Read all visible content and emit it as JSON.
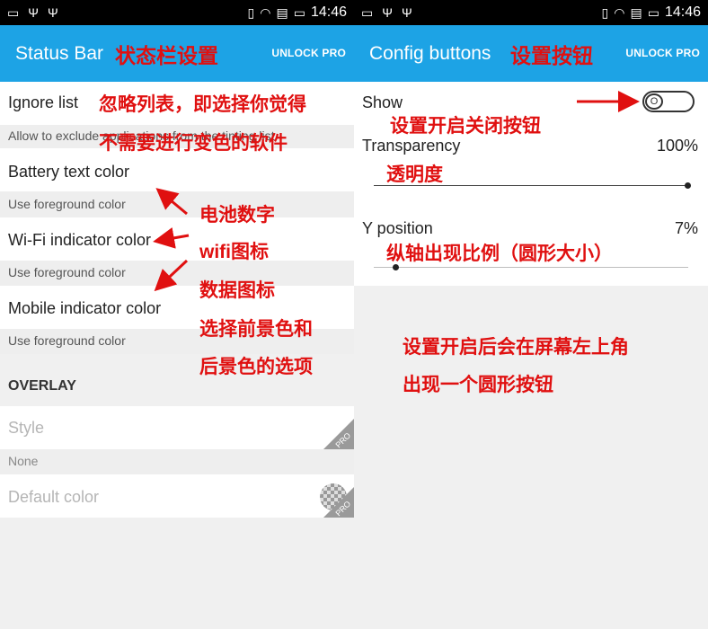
{
  "status_bar": {
    "time": "14:46"
  },
  "left": {
    "app_title": "Status Bar",
    "title_note": "状态栏设置",
    "unlock_label": "UNLOCK PRO",
    "items": [
      {
        "title": "Ignore list",
        "subtitle": "Allow to exclude applications from the tinting list"
      },
      {
        "title": "Battery text color",
        "subtitle": "Use foreground color"
      },
      {
        "title": "Wi-Fi indicator color",
        "subtitle": "Use foreground color"
      },
      {
        "title": "Mobile indicator color",
        "subtitle": "Use foreground color"
      }
    ],
    "overlay_header": "OVERLAY",
    "style_label": "Style",
    "style_value": "None",
    "default_color_label": "Default color",
    "pro_badge": "PRO",
    "notes": {
      "ignore_line1": "忽略列表，即选择你觉得",
      "ignore_line2": "不需要进行变色的软件",
      "battery": "电池数字",
      "wifi": "wifi图标",
      "mobile": "数据图标",
      "choose1": "选择前景色和",
      "choose2": "后景色的选项"
    }
  },
  "right": {
    "app_title": "Config buttons",
    "title_note": "设置按钮",
    "unlock_label": "UNLOCK PRO",
    "show_label": "Show",
    "toggle_text": "O",
    "transparency_label": "Transparency",
    "transparency_value": "100%",
    "transparency_level": 1.0,
    "y_position_label": "Y position",
    "y_position_value": "7%",
    "y_position_level": 0.07,
    "notes": {
      "show": "设置开启关闭按钮",
      "transparency": "透明度",
      "ypos": "纵轴出现比例（圆形大小）",
      "bottom1": "设置开启后会在屏幕左上角",
      "bottom2": "出现一个圆形按钮"
    }
  },
  "colors": {
    "appbar": "#1da3e5",
    "annotation": "#e01010"
  }
}
